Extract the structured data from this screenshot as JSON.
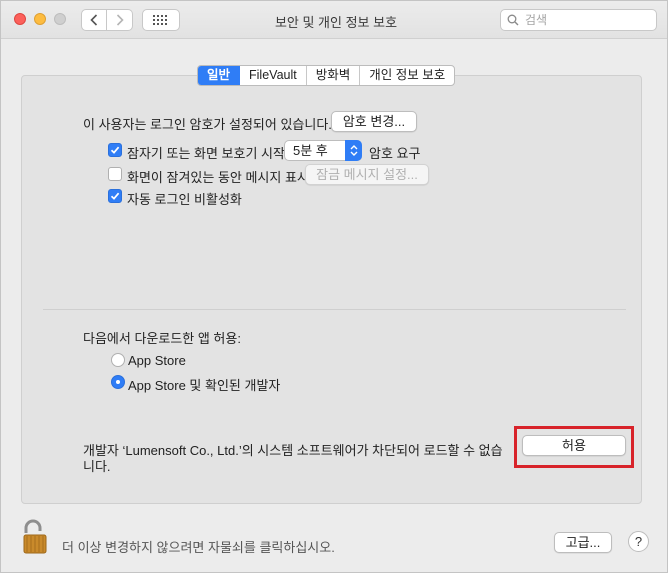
{
  "window": {
    "title": "보안 및 개인 정보 보호"
  },
  "toolbar": {
    "search_placeholder": "검색"
  },
  "tabs": [
    {
      "label": "일반",
      "active": true
    },
    {
      "label": "FileVault",
      "active": false
    },
    {
      "label": "방화벽",
      "active": false
    },
    {
      "label": "개인 정보 보호",
      "active": false
    }
  ],
  "general": {
    "password_set_text": "이 사용자는 로그인 암호가 설정되어 있습니다.",
    "change_password_button": "암호 변경...",
    "require_password": {
      "label": "잠자기 또는 화면 보호기 시작",
      "checked": true,
      "delay_value": "5분 후",
      "suffix": "암호 요구"
    },
    "show_message": {
      "label": "화면이 잠겨있는 동안 메시지 표시",
      "checked": false,
      "button": "잠금 메시지 설정..."
    },
    "disable_auto_login": {
      "label": "자동 로그인 비활성화",
      "checked": true
    }
  },
  "downloads": {
    "heading": "다음에서 다운로드한 앱 허용:",
    "options": [
      {
        "label": "App Store",
        "selected": false
      },
      {
        "label": "App Store 및 확인된 개발자",
        "selected": true
      }
    ],
    "blocked_message_line1": "개발자 ‘Lumensoft Co., Ltd.’의 시스템 소프트웨어가 차단되어 로드할 수 없습",
    "blocked_message_line2": "니다.",
    "allow_button": "허용"
  },
  "footer": {
    "lock_text": "더 이상 변경하지 않으려면 자물쇠를 클릭하십시오.",
    "advanced_button": "고급...",
    "help_button": "?"
  },
  "colors": {
    "accent": "#2f7df6",
    "highlight": "#d8232a"
  }
}
